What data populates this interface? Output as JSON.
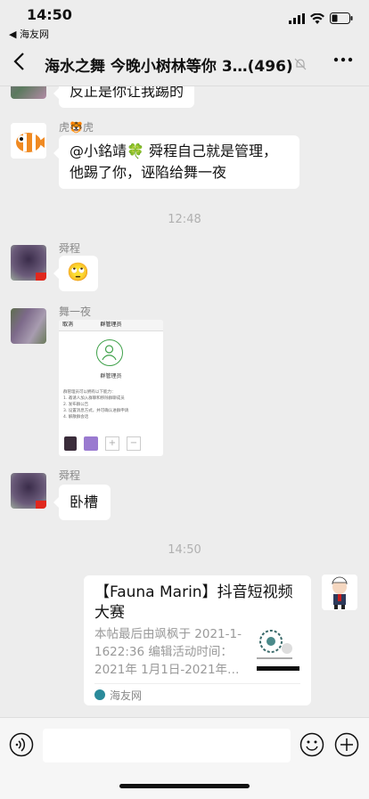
{
  "status": {
    "time": "14:50",
    "back_app": "◀ 海友网"
  },
  "nav": {
    "title": "海水之舞 今晚小树林等你 3…(496)"
  },
  "messages": {
    "m1": "反正是你让我踢的",
    "m2_sender": "虎🐯虎",
    "m2_text": "@小銘靖🍀 舜程自己就是管理，他踢了你，诬陷给舞一夜",
    "ts1": "12:48",
    "m3_sender": "舜程",
    "m3_emoji": "🙄",
    "m4_sender": "舞一夜",
    "m4_shot_header_left": "取消",
    "m4_shot_header_title": "群管理员",
    "m4_shot_role": "群管理员",
    "m4_shot_lines": [
      "群管理员可以拥有以下能力：",
      "1. 邀请人加入群聊和移除群聊成员",
      "2. 发布群公告",
      "3. 设置消息方式，并可确认进群申请",
      "4. 解散群会话"
    ],
    "m5_sender": "舜程",
    "m5_text": "卧槽",
    "ts2": "14:50",
    "link_title": "【Fauna Marin】抖音短视频大赛",
    "link_desc": "本帖最后由飒枫于 2021-1-1622:36 编辑活动时间：2021年 1月1日-2021年…",
    "link_source": "海友网"
  },
  "colors": {
    "background": "#ededed",
    "bubble": "#ffffff",
    "muted": "#888888"
  }
}
